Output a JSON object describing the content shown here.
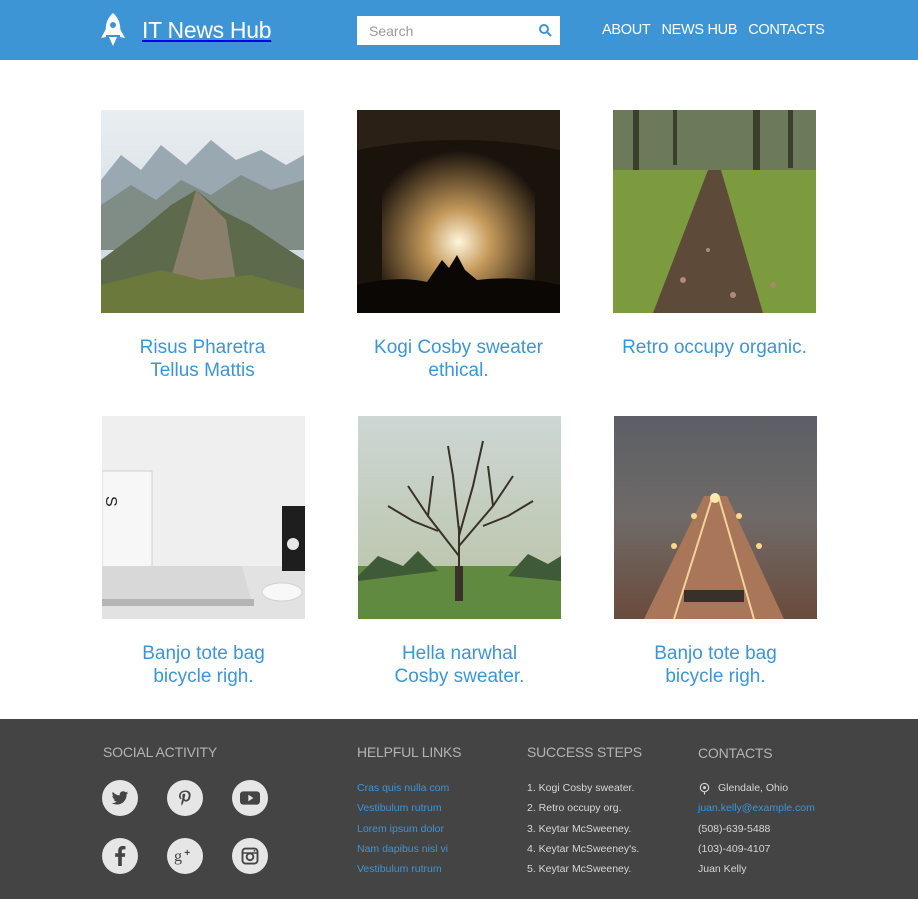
{
  "header": {
    "brand": "IT News Hub",
    "search_placeholder": "Search",
    "nav": [
      "ABOUT",
      "NEWS HUB",
      "CONTACTS"
    ]
  },
  "articles": [
    {
      "title_line1": "Risus Pharetra",
      "title_line2": "Tellus Mattis",
      "image": "mountain ridge landscape"
    },
    {
      "title_line1": "Kogi Cosby sweater",
      "title_line2": "ethical.",
      "image": "concert crowd under stage lights"
    },
    {
      "title_line1": "Retro occupy organic.",
      "title_line2": "",
      "image": "forest trail path"
    },
    {
      "title_line1": "Banjo tote bag",
      "title_line2": "bicycle righ.",
      "image": "laptop on white desk"
    },
    {
      "title_line1": "Hella narwhal",
      "title_line2": "Cosby sweater.",
      "image": "bare tree in park"
    },
    {
      "title_line1": "Banjo tote bag",
      "title_line2": "bicycle righ.",
      "image": "railway station lights at dusk"
    }
  ],
  "footer": {
    "social_heading": "SOCIAL ACTIVITY",
    "social_icons": [
      "twitter-icon",
      "pinterest-icon",
      "youtube-icon",
      "facebook-icon",
      "google-plus-icon",
      "instagram-icon"
    ],
    "links_heading": "HELPFUL LINKS",
    "links": [
      "Cras quis nulla com",
      "Vestibulum rutrum",
      "Lorem ipsum dolor",
      "Nam dapibus nisl vi",
      "Vestibulum rutrum"
    ],
    "steps_heading": "SUCCESS STEPS",
    "steps": [
      "1. Kogi Cosby sweater.",
      "2. Retro occupy org.",
      "3. Keytar McSweeney.",
      "4. Keytar McSweeney's.",
      "5. Keytar McSweeney."
    ],
    "contacts_heading": "CONTACTS",
    "contacts": {
      "location": "Glendale, Ohio",
      "email": "juan.kelly@example.com",
      "phone1": "(508)-639-5488",
      "phone2": "(103)-409-4107",
      "name": "Juan Kelly"
    }
  },
  "colors": {
    "accent": "#3d95d6",
    "footer_bg": "#444444"
  }
}
